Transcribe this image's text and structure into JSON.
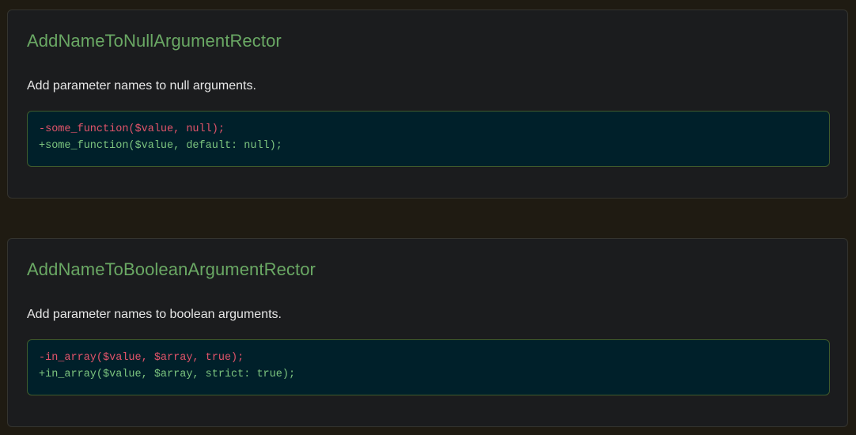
{
  "rules": [
    {
      "title": "AddNameToNullArgumentRector",
      "description": "Add parameter names to null arguments.",
      "diff": {
        "removed": "-some_function($value, null);",
        "added": "+some_function($value, default: null);"
      }
    },
    {
      "title": "AddNameToBooleanArgumentRector",
      "description": "Add parameter names to boolean arguments.",
      "diff": {
        "removed": "-in_array($value, $array, true);",
        "added": "+in_array($value, $array, strict: true);"
      }
    }
  ],
  "colors": {
    "page_background": "#1f1b12",
    "card_background": "#1b1c1e",
    "title": "#6aa864",
    "code_background": "#00202a",
    "removed_line": "#e2546a",
    "added_line": "#7cc47f"
  }
}
